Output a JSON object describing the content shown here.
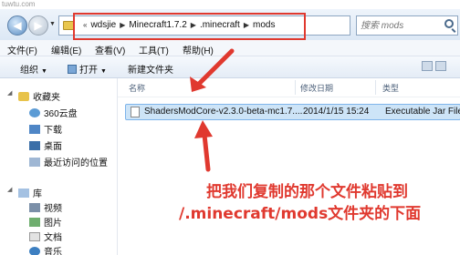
{
  "watermark": "tuwtu.com",
  "address_bar": {
    "crumbs": [
      "wdsjie",
      "Minecraft1.7.2",
      ".minecraft",
      "mods"
    ],
    "search_placeholder": "搜索 mods"
  },
  "menu": [
    "文件(F)",
    "编辑(E)",
    "查看(V)",
    "工具(T)",
    "帮助(H)"
  ],
  "toolbar": {
    "organize": "组织",
    "open": "打开",
    "new_folder": "新建文件夹"
  },
  "nav_pane": {
    "favorites": "收藏夹",
    "items": [
      "360云盘",
      "下载",
      "桌面",
      "最近访问的位置"
    ],
    "libraries": "库",
    "library_items": [
      "视频",
      "图片",
      "文档",
      "音乐"
    ]
  },
  "columns": {
    "name": "名称",
    "date": "修改日期",
    "type": "类型"
  },
  "file": {
    "name": "ShadersModCore-v2.3.0-beta-mc1.7....",
    "date": "2014/1/15 15:24",
    "type": "Executable Jar File"
  },
  "annotation": {
    "line1": "把我们复制的那个文件粘贴到",
    "line2": "/.minecraft/mods文件夹的下面"
  },
  "colors": {
    "annotation": "#e0392f",
    "selection": "#cde4f7"
  }
}
